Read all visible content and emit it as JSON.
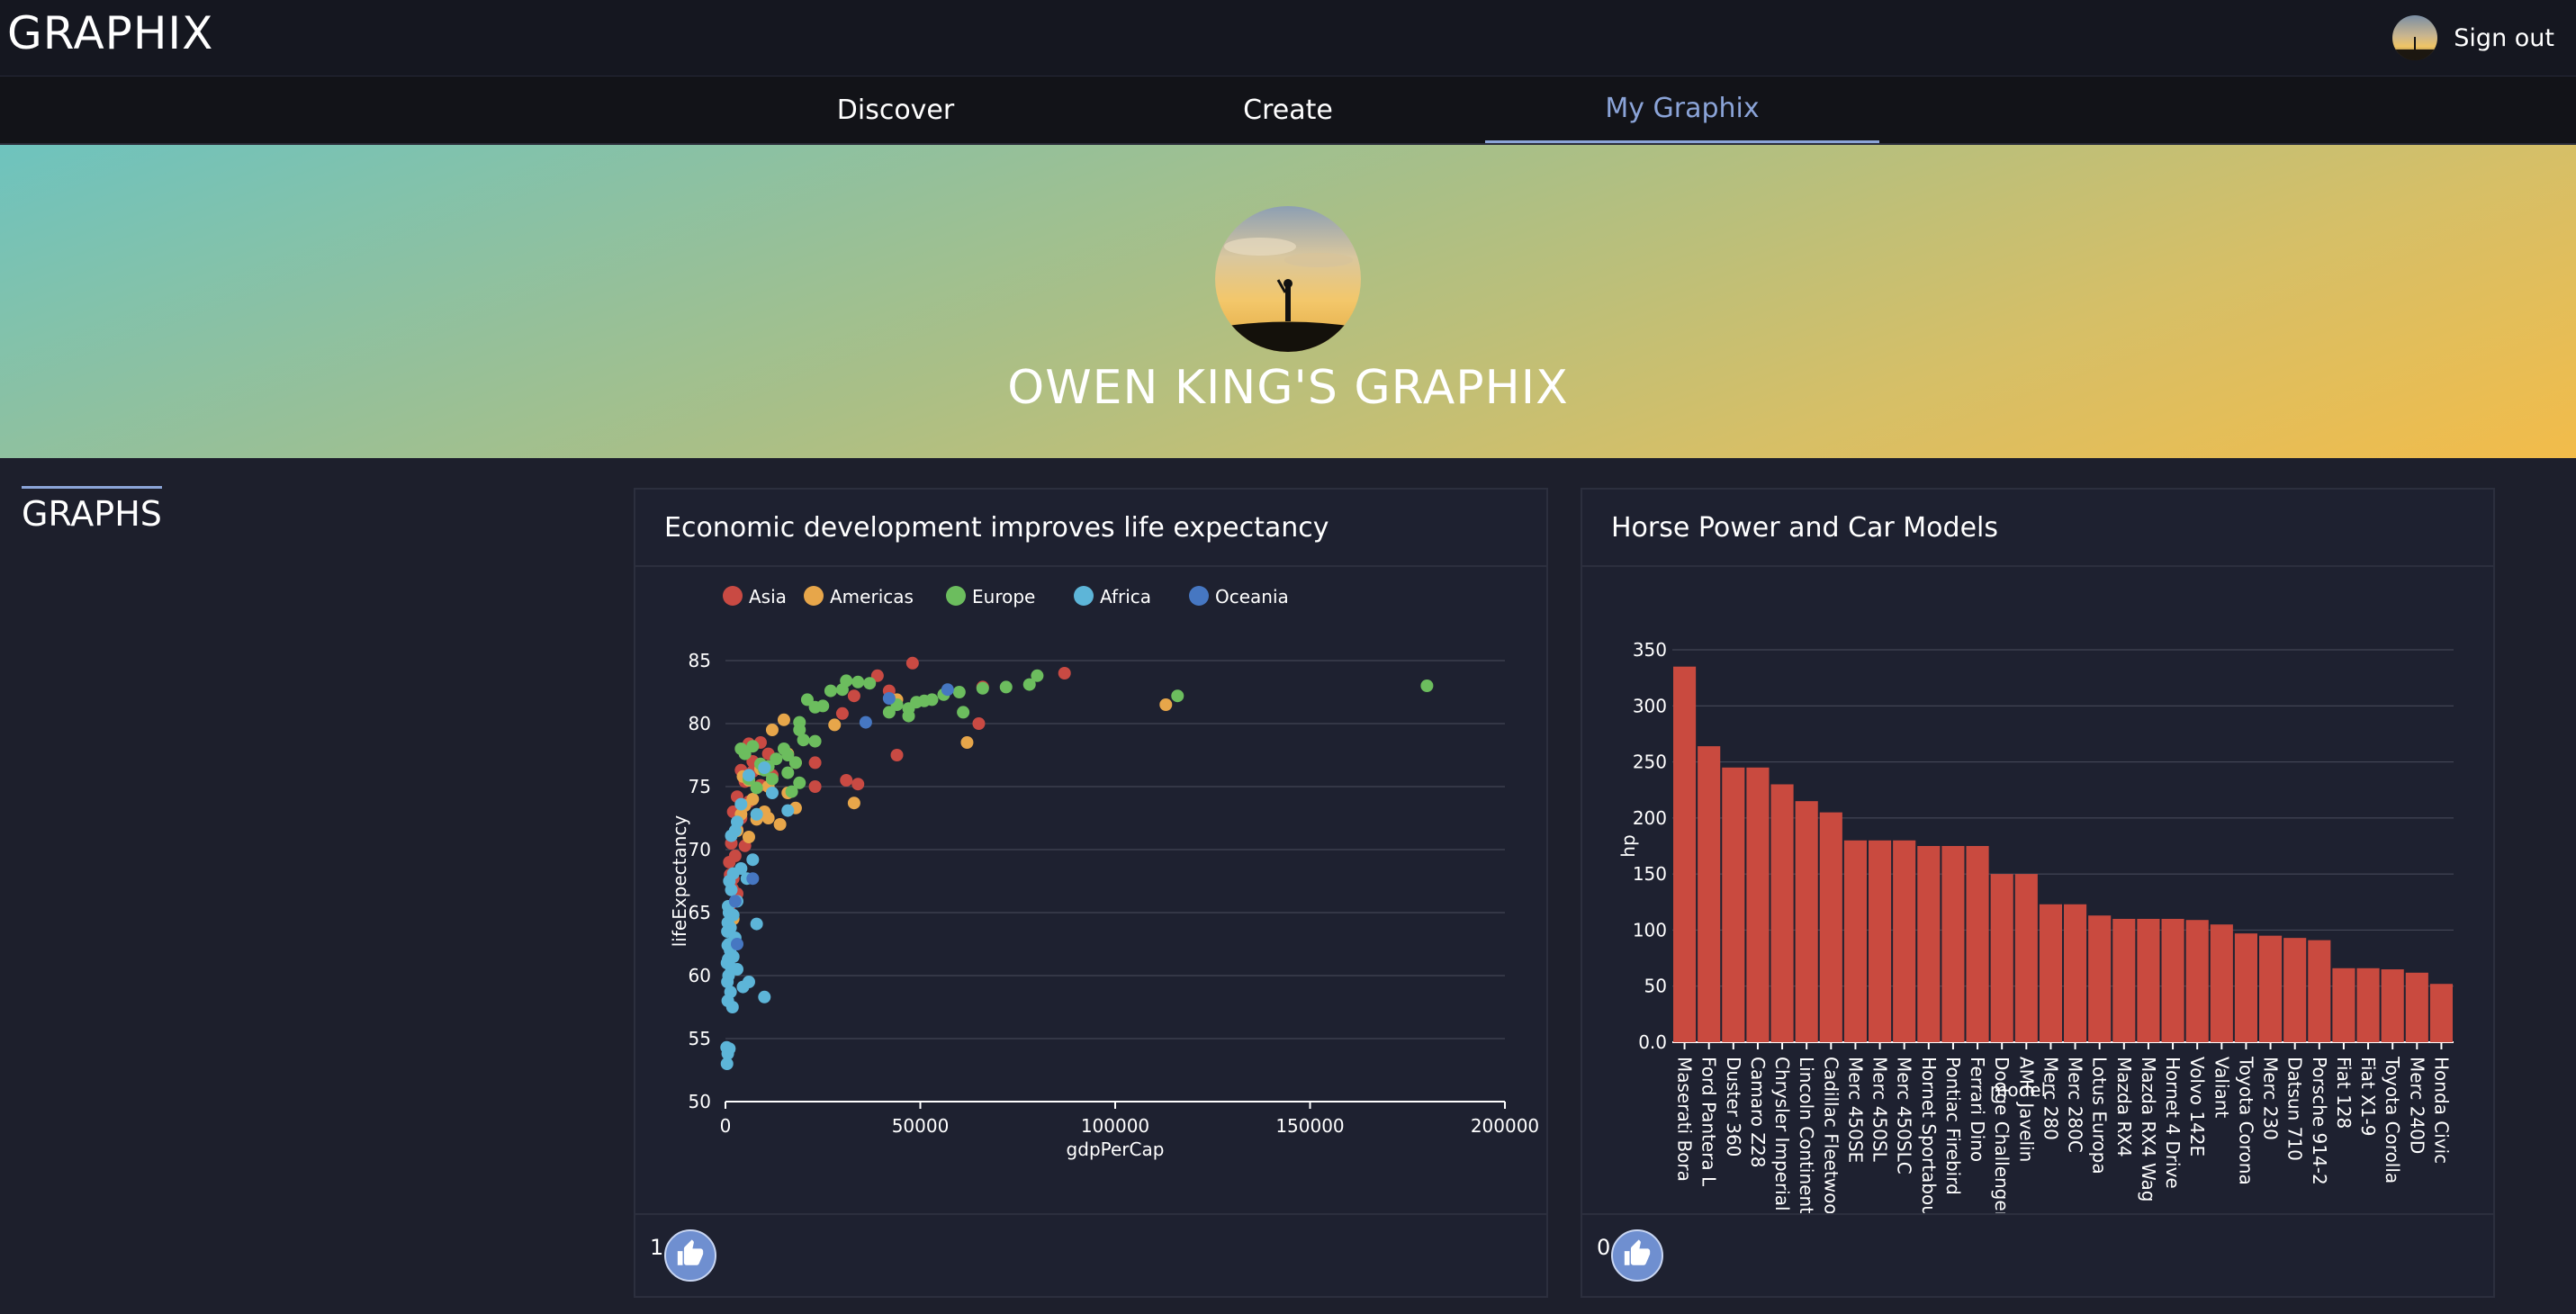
{
  "app": {
    "brand": "GRAPHIX",
    "sign_out": "Sign out"
  },
  "nav": {
    "tabs": [
      "Discover",
      "Create",
      "My Graphix"
    ],
    "active_index": 2
  },
  "profile": {
    "title": "OWEN KING'S GRAPHIX"
  },
  "section": {
    "heading": "GRAPHS"
  },
  "cards": [
    {
      "title": "Economic development improves life expectancy",
      "likes": "1"
    },
    {
      "title": "Horse Power and Car Models",
      "likes": "0"
    }
  ],
  "colors": {
    "asia": "#c94a43",
    "americas": "#e7a64a",
    "europe": "#6cbd5e",
    "africa": "#5db5d8",
    "oceania": "#4677c2",
    "bar": "#c94a3f",
    "accent": "#8ba4d8"
  },
  "icons": {
    "like": "thumbs-up-icon",
    "avatar": "profile-avatar"
  },
  "chart_data": [
    {
      "type": "scatter",
      "xlabel": "gdpPerCap",
      "ylabel": "lifeExpectancy",
      "xlim": [
        0,
        200000
      ],
      "ylim": [
        50,
        85
      ],
      "xticks": [
        "0",
        "50000",
        "100000",
        "150000",
        "200000"
      ],
      "yticks": [
        "50",
        "55",
        "60",
        "65",
        "70",
        "75",
        "80",
        "85"
      ],
      "legend_position": "top",
      "grid": true,
      "series": [
        {
          "name": "Asia",
          "color": "#c94a43",
          "points": [
            [
              48000,
              84.8
            ],
            [
              87000,
              84
            ],
            [
              39000,
              83.8
            ],
            [
              66000,
              82.9
            ],
            [
              42000,
              82.6
            ],
            [
              33000,
              82.2
            ],
            [
              30000,
              80.8
            ],
            [
              65000,
              80
            ],
            [
              44000,
              77.5
            ],
            [
              23000,
              76.9
            ],
            [
              31000,
              75.5
            ],
            [
              34000,
              75.2
            ],
            [
              23000,
              75
            ],
            [
              9000,
              78.5
            ],
            [
              6000,
              78.4
            ],
            [
              11000,
              77.6
            ],
            [
              7000,
              77
            ],
            [
              4000,
              76.3
            ],
            [
              5000,
              75.4
            ],
            [
              9000,
              75.1
            ],
            [
              3000,
              74.2
            ],
            [
              6000,
              73.8
            ],
            [
              2000,
              73
            ],
            [
              4000,
              72.5
            ],
            [
              3000,
              71.6
            ],
            [
              1500,
              70.5
            ],
            [
              5000,
              70.3
            ],
            [
              2500,
              69.5
            ],
            [
              1000,
              69
            ],
            [
              1200,
              68
            ],
            [
              2000,
              67.7
            ],
            [
              1800,
              66.9
            ],
            [
              3000,
              66.5
            ],
            [
              1000,
              65.5
            ],
            [
              7000,
              76.2
            ],
            [
              12000,
              75.9
            ]
          ]
        },
        {
          "name": "Americas",
          "color": "#e7a64a",
          "points": [
            [
              44000,
              81.9
            ],
            [
              62000,
              78.5
            ],
            [
              28000,
              79.9
            ],
            [
              33000,
              73.7
            ],
            [
              113000,
              81.5
            ],
            [
              15000,
              80.3
            ],
            [
              12000,
              79.5
            ],
            [
              16000,
              77.6
            ],
            [
              18000,
              76.9
            ],
            [
              9000,
              76.4
            ],
            [
              6000,
              75.5
            ],
            [
              11000,
              75
            ],
            [
              16000,
              74.5
            ],
            [
              7000,
              74
            ],
            [
              5000,
              73.5
            ],
            [
              18000,
              73.3
            ],
            [
              10000,
              73
            ],
            [
              4000,
              72.8
            ],
            [
              8000,
              72.4
            ],
            [
              14000,
              72
            ],
            [
              3000,
              71.5
            ],
            [
              6000,
              71
            ],
            [
              2000,
              64.5
            ],
            [
              11000,
              72.5
            ],
            [
              4500,
              75.8
            ]
          ]
        },
        {
          "name": "Europe",
          "color": "#6cbd5e",
          "points": [
            [
              180000,
              83
            ],
            [
              116000,
              82.2
            ],
            [
              80000,
              83.8
            ],
            [
              78000,
              83.1
            ],
            [
              72000,
              82.9
            ],
            [
              66000,
              82.8
            ],
            [
              60000,
              82.5
            ],
            [
              56000,
              82.3
            ],
            [
              53000,
              81.9
            ],
            [
              51000,
              81.8
            ],
            [
              49000,
              81.7
            ],
            [
              47000,
              81.2
            ],
            [
              44000,
              81.5
            ],
            [
              42000,
              80.9
            ],
            [
              37000,
              83.2
            ],
            [
              34000,
              83.3
            ],
            [
              31000,
              83.4
            ],
            [
              30000,
              82.7
            ],
            [
              27000,
              82.6
            ],
            [
              25000,
              81.4
            ],
            [
              23000,
              81.3
            ],
            [
              21000,
              81.9
            ],
            [
              61000,
              80.9
            ],
            [
              47000,
              80.6
            ],
            [
              19000,
              80.1
            ],
            [
              19000,
              79.5
            ],
            [
              20000,
              78.7
            ],
            [
              23000,
              78.6
            ],
            [
              15000,
              78
            ],
            [
              16000,
              77.5
            ],
            [
              13000,
              77.2
            ],
            [
              18000,
              76.9
            ],
            [
              9000,
              76.8
            ],
            [
              11000,
              76.6
            ],
            [
              16000,
              76.1
            ],
            [
              12000,
              75.6
            ],
            [
              6000,
              75.6
            ],
            [
              19000,
              75.3
            ],
            [
              7000,
              78.2
            ],
            [
              5000,
              77.6
            ],
            [
              10000,
              76.3
            ],
            [
              8000,
              74.9
            ],
            [
              17000,
              74.6
            ],
            [
              4000,
              78
            ]
          ]
        },
        {
          "name": "Africa",
          "color": "#5db5d8",
          "points": [
            [
              10000,
              76.5
            ],
            [
              6000,
              75.9
            ],
            [
              12000,
              74.5
            ],
            [
              4000,
              73.6
            ],
            [
              16000,
              73.1
            ],
            [
              8000,
              72.8
            ],
            [
              3000,
              72.2
            ],
            [
              2500,
              71.5
            ],
            [
              1500,
              71.1
            ],
            [
              7000,
              69.2
            ],
            [
              4000,
              68.5
            ],
            [
              2000,
              68.1
            ],
            [
              1000,
              67.5
            ],
            [
              5500,
              67.7
            ],
            [
              1500,
              66.8
            ],
            [
              3000,
              65.9
            ],
            [
              700,
              65.5
            ],
            [
              900,
              65
            ],
            [
              2000,
              64.8
            ],
            [
              600,
              64.2
            ],
            [
              8000,
              64.1
            ],
            [
              1300,
              63.8
            ],
            [
              500,
              63.5
            ],
            [
              2500,
              63
            ],
            [
              900,
              62.5
            ],
            [
              600,
              62.4
            ],
            [
              1200,
              62
            ],
            [
              2000,
              61.5
            ],
            [
              700,
              61.3
            ],
            [
              400,
              61
            ],
            [
              1500,
              60.6
            ],
            [
              3000,
              60.5
            ],
            [
              800,
              60
            ],
            [
              500,
              59.5
            ],
            [
              6000,
              59.5
            ],
            [
              4500,
              59.1
            ],
            [
              1300,
              58.7
            ],
            [
              10000,
              58.3
            ],
            [
              600,
              58
            ],
            [
              1800,
              57.5
            ],
            [
              300,
              54.3
            ],
            [
              1000,
              54.2
            ],
            [
              600,
              53.8
            ],
            [
              400,
              53
            ]
          ]
        },
        {
          "name": "Oceania",
          "color": "#4677c2",
          "points": [
            [
              57000,
              82.7
            ],
            [
              42000,
              82
            ],
            [
              36000,
              80.1
            ],
            [
              7000,
              67.7
            ],
            [
              2500,
              65.9
            ],
            [
              3000,
              62.5
            ]
          ]
        }
      ]
    },
    {
      "type": "bar",
      "xlabel": "model",
      "ylabel": "hp",
      "ylim": [
        0,
        350
      ],
      "yticks": [
        "0.0",
        "50",
        "100",
        "150",
        "200",
        "250",
        "300",
        "350"
      ],
      "grid": true,
      "categories": [
        "Maserati Bora",
        "Ford Pantera L",
        "Duster 360",
        "Camaro Z28",
        "Chrysler Imperial",
        "Lincoln Continenta",
        "Cadillac Fleetwooc",
        "Merc 450SE",
        "Merc 450SL",
        "Merc 450SLC",
        "Hornet Sportabou",
        "Pontiac Firebird",
        "Ferrari Dino",
        "Dodge Challenger",
        "AMC Javelin",
        "Merc 280",
        "Merc 280C",
        "Lotus Europa",
        "Mazda RX4",
        "Mazda RX4 Wag",
        "Hornet 4 Drive",
        "Volvo 142E",
        "Valiant",
        "Toyota Corona",
        "Merc 230",
        "Datsun 710",
        "Porsche 914-2",
        "Fiat 128",
        "Fiat X1-9",
        "Toyota Corolla",
        "Merc 240D",
        "Honda Civic"
      ],
      "values": [
        335,
        264,
        245,
        245,
        230,
        215,
        205,
        180,
        180,
        180,
        175,
        175,
        175,
        150,
        150,
        123,
        123,
        113,
        110,
        110,
        110,
        109,
        105,
        97,
        95,
        93,
        91,
        66,
        66,
        65,
        62,
        52
      ]
    }
  ]
}
